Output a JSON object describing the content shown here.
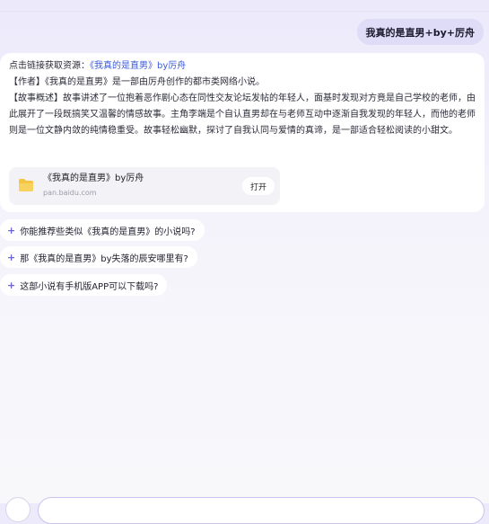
{
  "user_query": "我真的是直男+by+厉舟",
  "answer": {
    "link_prefix": "点击链接获取资源：",
    "link_text": "《我真的是直男》by厉舟",
    "author_line": "【作者】《我真的是直男》是一部由厉舟创作的都市类网络小说。",
    "summary": "【故事概述】故事讲述了一位抱着恶作剧心态在同性交友论坛发帖的年轻人，面基时发现对方竟是自己学校的老师，由此展开了一段既搞笑又温馨的情感故事。主角李端是个自认直男却在与老师互动中逐渐自我发现的年轻人，而他的老师则是一位文静内敛的纯情稳重受。故事轻松幽默，探讨了自我认同与爱情的真谛，是一部适合轻松阅读的小甜文。"
  },
  "resource": {
    "title": "《我真的是直男》by厉舟",
    "domain": "pan.baidu.com",
    "open_label": "打开",
    "icon": "folder-icon"
  },
  "suggestions": [
    "你能推荐些类似《我真的是直男》的小说吗?",
    "那《我真的是直男》by失落的辰安哪里有?",
    "这部小说有手机版APP可以下载吗?"
  ],
  "colors": {
    "accent": "#6c63d8",
    "link": "#3b5bdb",
    "user_bubble": "#dedcf7",
    "folder": "#f5c542"
  }
}
